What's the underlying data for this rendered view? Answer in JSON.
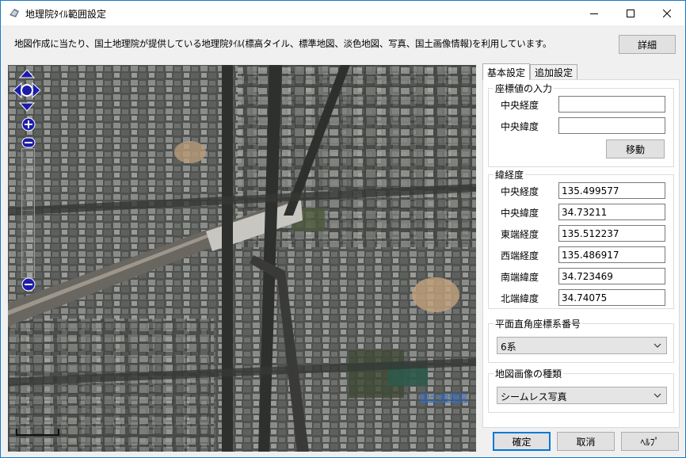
{
  "window": {
    "title": "地理院ﾀｲﾙ範囲設定",
    "icon": "app-icon",
    "controls": [
      "minimize-icon",
      "maximize-icon",
      "close-icon"
    ]
  },
  "description": "地図作成に当たり、国土地理院が提供している地理院ﾀｲﾙ(標高タイル、標準地図、淡色地図、写真、国土画像情報)を利用しています。",
  "detail_button": "詳細",
  "map": {
    "credit": "国土地理院",
    "nav_icons": [
      "pan-up-icon",
      "pan-left-icon",
      "pan-right-icon",
      "pan-down-icon"
    ],
    "zoom_in": "zoom-in-icon",
    "zoom_out": "zoom-out-icon"
  },
  "tabs": [
    {
      "label": "基本設定",
      "active": true
    },
    {
      "label": "追加設定",
      "active": false
    }
  ],
  "coord_input": {
    "title": "座標値の入力",
    "lon_label": "中央経度",
    "lat_label": "中央緯度",
    "lon_value": "",
    "lat_value": "",
    "move_button": "移動"
  },
  "latlon": {
    "title": "緯経度",
    "fields": [
      {
        "label": "中央経度",
        "value": "135.499577"
      },
      {
        "label": "中央緯度",
        "value": "34.73211"
      },
      {
        "label": "東端経度",
        "value": "135.512237"
      },
      {
        "label": "西端経度",
        "value": "135.486917"
      },
      {
        "label": "南端緯度",
        "value": "34.723469"
      },
      {
        "label": "北端緯度",
        "value": "34.74075"
      }
    ]
  },
  "plane_rect": {
    "title": "平面直角座標系番号",
    "selected": "6系"
  },
  "image_type": {
    "title": "地図画像の種類",
    "selected": "シームレス写真"
  },
  "footer": {
    "ok": "確定",
    "cancel": "取消",
    "help": "ﾍﾙﾌﾟ"
  }
}
